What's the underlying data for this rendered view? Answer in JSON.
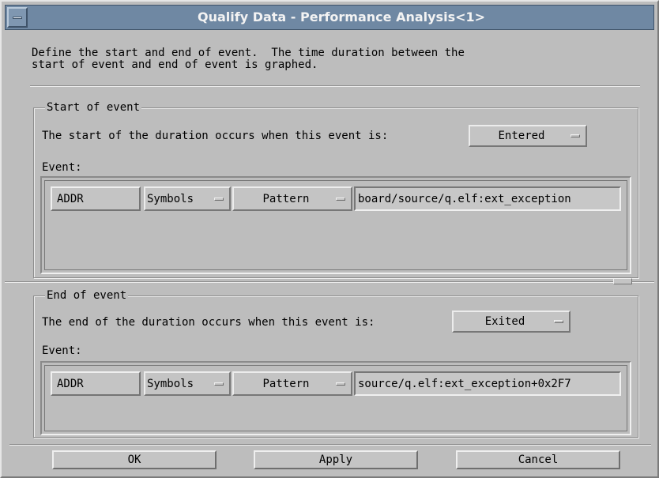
{
  "window": {
    "title": "Qualify Data - Performance Analysis<1>"
  },
  "description": "Define the start and end of event.  The time duration between the\nstart of event and end of event is graphed.",
  "start_group": {
    "legend": "Start of event",
    "prompt": "The start of the duration occurs when this event is:",
    "when_value": "Entered",
    "event_label": "Event:",
    "row": {
      "bus": "ADDR",
      "format": "Symbols",
      "mode": "Pattern",
      "value": "board/source/q.elf:ext_exception"
    }
  },
  "end_group": {
    "legend": "End of event",
    "prompt": "The end of the duration occurs when this event is:",
    "when_value": "Exited",
    "event_label": "Event:",
    "row": {
      "bus": "ADDR",
      "format": "Symbols",
      "mode": "Pattern",
      "value": "source/q.elf:ext_exception+0x2F7"
    }
  },
  "buttons": {
    "ok": "OK",
    "apply": "Apply",
    "cancel": "Cancel"
  },
  "colors": {
    "titlebar": "#6f88a3",
    "background": "#bdbdbd",
    "title_text": "#f3f3f3"
  }
}
